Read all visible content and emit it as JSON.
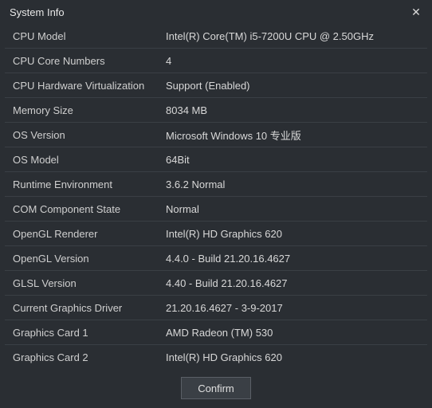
{
  "window": {
    "title": "System Info"
  },
  "rows": [
    {
      "label": "CPU Model",
      "value": "Intel(R) Core(TM) i5-7200U CPU @ 2.50GHz"
    },
    {
      "label": "CPU Core Numbers",
      "value": "4"
    },
    {
      "label": "CPU Hardware Virtualization",
      "value": "Support (Enabled)"
    },
    {
      "label": "Memory Size",
      "value": "8034 MB"
    },
    {
      "label": "OS Version",
      "value": "Microsoft Windows 10 专业版"
    },
    {
      "label": "OS Model",
      "value": "64Bit"
    },
    {
      "label": "Runtime Environment",
      "value": "3.6.2 Normal"
    },
    {
      "label": "COM Component State",
      "value": "Normal"
    },
    {
      "label": "OpenGL Renderer",
      "value": "Intel(R) HD Graphics 620"
    },
    {
      "label": "OpenGL Version",
      "value": "4.4.0 - Build 21.20.16.4627"
    },
    {
      "label": "GLSL Version",
      "value": "4.40 - Build 21.20.16.4627"
    },
    {
      "label": "Current Graphics Driver",
      "value": "21.20.16.4627 - 3-9-2017"
    },
    {
      "label": "Graphics Card 1",
      "value": "AMD Radeon (TM) 530"
    },
    {
      "label": "Graphics Card 2",
      "value": "Intel(R) HD Graphics 620"
    }
  ],
  "footer": {
    "confirm_label": "Confirm"
  }
}
